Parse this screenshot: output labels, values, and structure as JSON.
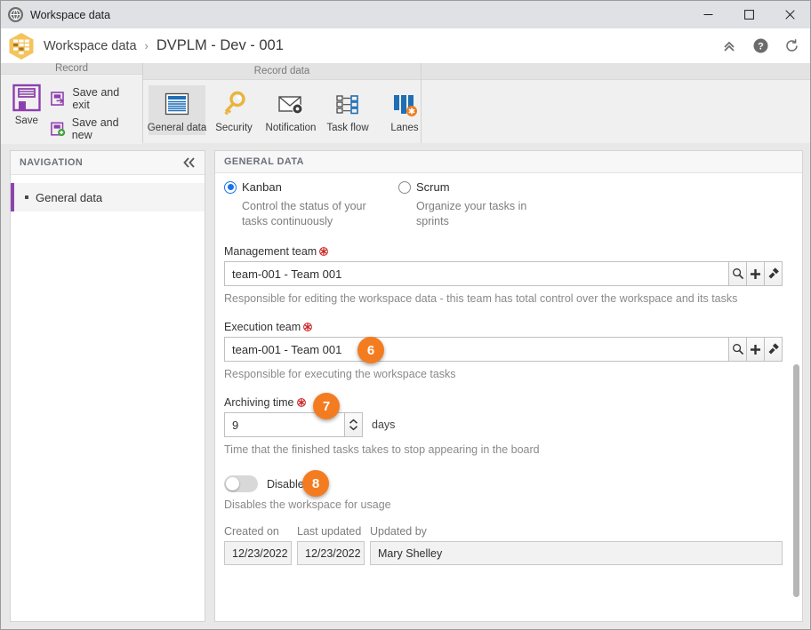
{
  "window": {
    "title": "Workspace data",
    "icon": "globe-icon",
    "minimize": "minimize-icon",
    "maximize": "maximize-icon",
    "close": "close-icon"
  },
  "header": {
    "app_icon": "kanban-board-icon",
    "breadcrumb_root": "Workspace data",
    "separator": "›",
    "breadcrumb_current": "DVPLM - Dev - 001",
    "actions": [
      {
        "name": "collapse-ribbon-button",
        "icon": "chevron-double-up-icon"
      },
      {
        "name": "help-button",
        "icon": "help-circle-icon"
      },
      {
        "name": "refresh-button",
        "icon": "refresh-icon"
      }
    ]
  },
  "ribbon": {
    "groups": [
      {
        "label": "Record"
      },
      {
        "label": "Record data"
      }
    ],
    "save": {
      "big_label": "Save",
      "save_and_exit": "Save and exit",
      "save_and_new": "Save and new"
    },
    "tabs": [
      {
        "label": "General data",
        "icon": "document-lines-icon",
        "active": true
      },
      {
        "label": "Security",
        "icon": "key-icon",
        "active": false
      },
      {
        "label": "Notification",
        "icon": "envelope-gear-icon",
        "active": false
      },
      {
        "label": "Task flow",
        "icon": "task-flow-icon",
        "active": false
      },
      {
        "label": "Lanes",
        "icon": "lanes-icon",
        "active": false
      }
    ]
  },
  "navigation": {
    "title": "NAVIGATION",
    "collapse_icon": "chevron-double-left-icon",
    "items": [
      {
        "label": "General data",
        "selected": true
      }
    ]
  },
  "form": {
    "section_title": "GENERAL DATA",
    "method": {
      "options": [
        {
          "label": "Kanban",
          "description": "Control the status of your tasks continuously",
          "selected": true
        },
        {
          "label": "Scrum",
          "description": "Organize your tasks in sprints",
          "selected": false
        }
      ]
    },
    "management_team": {
      "label": "Management team",
      "required_icon": "required-asterisk-icon",
      "value": "team-001 - Team 001",
      "hint": "Responsible for editing the workspace data - this team has total control over the workspace and its tasks",
      "buttons": [
        {
          "name": "search-team-button",
          "icon": "magnifier-icon"
        },
        {
          "name": "add-team-button",
          "icon": "plus-icon"
        },
        {
          "name": "clear-team-button",
          "icon": "brush-icon"
        }
      ]
    },
    "execution_team": {
      "label": "Execution team",
      "required_icon": "required-asterisk-icon",
      "value": "team-001 - Team 001",
      "hint": "Responsible for executing the workspace tasks",
      "buttons": [
        {
          "name": "search-team-button",
          "icon": "magnifier-icon"
        },
        {
          "name": "add-team-button",
          "icon": "plus-icon"
        },
        {
          "name": "clear-team-button",
          "icon": "brush-icon"
        }
      ]
    },
    "archiving_time": {
      "label": "Archiving time",
      "required_icon": "required-asterisk-icon",
      "value": "9",
      "unit": "days",
      "hint": "Time that the finished tasks takes to stop appearing in the board"
    },
    "disable": {
      "label": "Disable",
      "state": "off",
      "hint": "Disables the workspace for usage"
    },
    "meta": {
      "created_on_label": "Created on",
      "created_on_value": "12/23/2022",
      "last_updated_label": "Last updated",
      "last_updated_value": "12/23/2022",
      "updated_by_label": "Updated by",
      "updated_by_value": "Mary Shelley"
    }
  },
  "badges": [
    {
      "number": "6",
      "target": "execution-team-field"
    },
    {
      "number": "7",
      "target": "archiving-time-field"
    },
    {
      "number": "8",
      "target": "disable-toggle"
    }
  ],
  "colors": {
    "accent_orange": "#f47c20",
    "radio_blue": "#1a73e8",
    "nav_accent_purple": "#8e44ad",
    "required_red": "#cc2222"
  }
}
